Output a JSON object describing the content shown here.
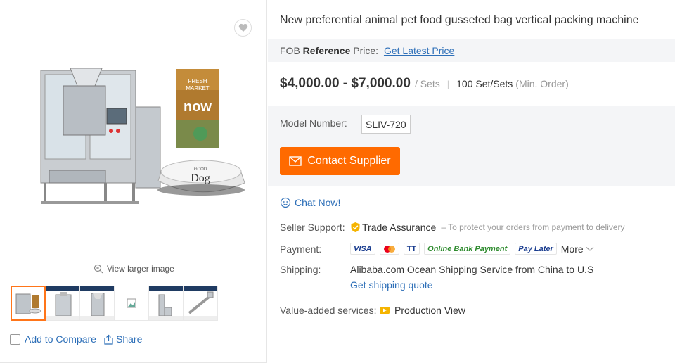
{
  "product": {
    "title": "New preferential animal pet food gusseted bag vertical packing machine",
    "fob_prefix": "FOB ",
    "fob_bold": "Reference",
    "fob_suffix": " Price:",
    "latest_price_link": "Get Latest Price",
    "price_range": "$4,000.00 - $7,000.00",
    "price_unit": "/ Sets",
    "separator": "|",
    "min_order": "100 Set/Sets",
    "min_order_note": "(Min. Order)",
    "model_label": "Model Number:",
    "model_value": "SLIV-720"
  },
  "actions": {
    "contact_supplier": "Contact Supplier",
    "chat_now": "Chat Now!"
  },
  "details": {
    "seller_support_label": "Seller Support:",
    "trade_assurance": "Trade Assurance",
    "trade_assurance_note": "– To protect your orders from payment to delivery",
    "payment_label": "Payment:",
    "payment_methods": [
      "VISA",
      "MC",
      "TT",
      "Online Bank Payment",
      "Pay Later"
    ],
    "more": "More",
    "shipping_label": "Shipping:",
    "shipping_text": "Alibaba.com Ocean Shipping Service from China to U.S",
    "shipping_quote": "Get shipping quote",
    "value_added_label": "Value-added services:",
    "production_view": "Production View"
  },
  "gallery": {
    "view_larger": "View larger image",
    "add_to_compare": "Add to Compare",
    "share": "Share",
    "bag_text_1": "FRESH",
    "bag_text_2": "MARKET",
    "bag_text_3": "now",
    "bowl_text_1": "GOOD",
    "bowl_text_2": "Dog",
    "thumbnail_count": 6
  },
  "colors": {
    "accent": "#ff6a00",
    "link": "#2d6fb8",
    "panel": "#f4f5f7"
  }
}
